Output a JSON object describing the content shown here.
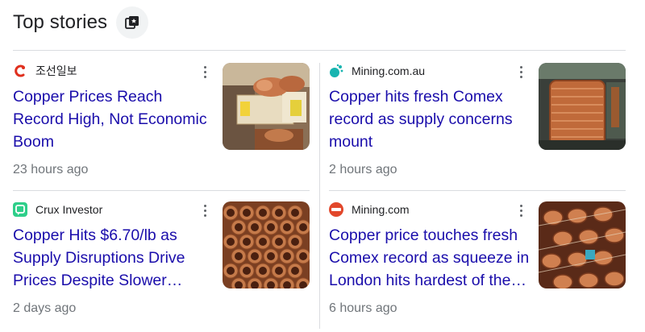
{
  "header": {
    "title": "Top stories",
    "icon": "save-collection-icon"
  },
  "stories": [
    {
      "source": "조선일보",
      "logo": "chosun-logo-icon",
      "headline": "Copper Prices Reach Record High, Not Economic Boom",
      "time": "23 hours ago",
      "thumb": "copper-fittings-shelf-image"
    },
    {
      "source": "Mining.com.au",
      "logo": "mining-com-au-logo-icon",
      "headline": "Copper hits fresh Comex record as supply concerns mount",
      "time": "2 hours ago",
      "thumb": "copper-wire-spools-image"
    },
    {
      "source": "Crux Investor",
      "logo": "crux-investor-logo-icon",
      "headline": "Copper Hits $6.70/lb as Supply Disruptions Drive Prices Despite Slower Demand Growth",
      "time": "2 days ago",
      "thumb": "copper-pipes-stack-image"
    },
    {
      "source": "Mining.com",
      "logo": "mining-com-logo-icon",
      "headline": "Copper price touches fresh Comex record as squeeze in London hits hardest of the year",
      "time": "6 hours ago",
      "thumb": "copper-coils-machinery-image"
    }
  ],
  "colors": {
    "link": "#1a0dab",
    "meta": "#70757a",
    "divider": "#dadce0",
    "copper": "#b86a3c"
  }
}
